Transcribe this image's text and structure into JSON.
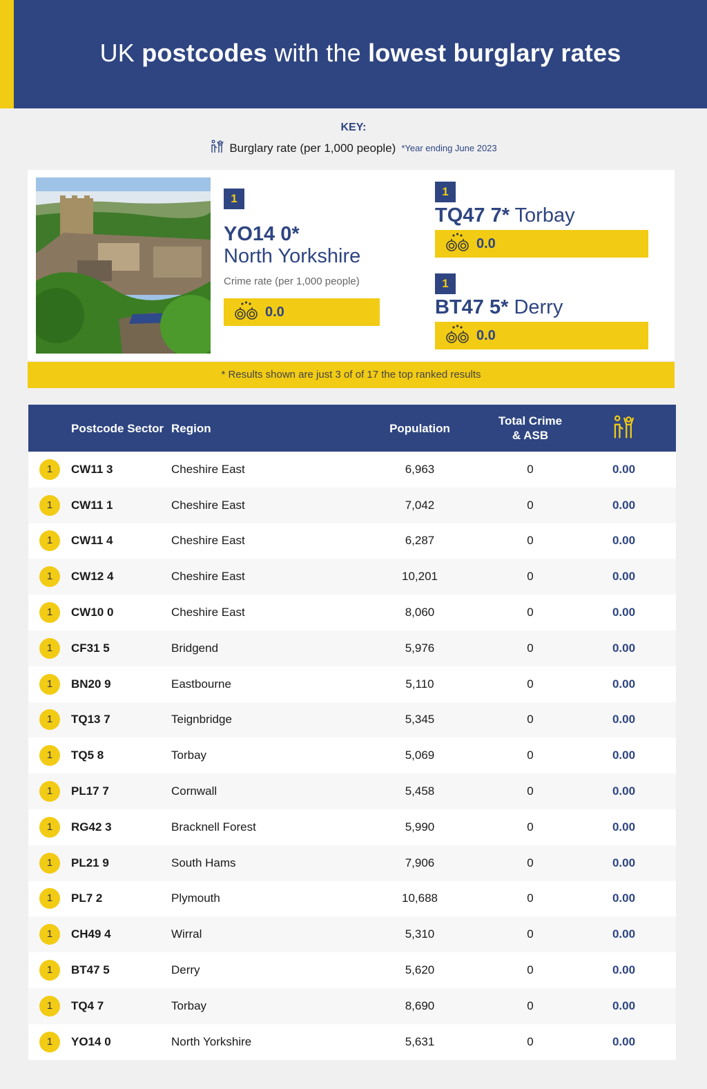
{
  "header": {
    "title_parts": [
      {
        "text": "UK ",
        "bold": false
      },
      {
        "text": "postcodes",
        "bold": true
      },
      {
        "text": " with the ",
        "bold": false
      },
      {
        "text": "lowest burglary rates",
        "bold": true
      }
    ]
  },
  "key": {
    "label": "KEY:",
    "icon": "burglary-figures-icon",
    "text": "Burglary rate (per 1,000 people)",
    "note": "*Year ending June 2023"
  },
  "featured": {
    "primary": {
      "rank": "1",
      "code": "YO14 0*",
      "region": "North Yorkshire",
      "caption": "Crime rate (per 1,000 people)",
      "icon": "handcuffs-icon",
      "rate": "0.0",
      "image_alt": "Town with castle keep among green trees"
    },
    "secondary": [
      {
        "rank": "1",
        "code": "TQ47 7*",
        "region": "Torbay",
        "icon": "handcuffs-icon",
        "rate": "0.0"
      },
      {
        "rank": "1",
        "code": "BT47 5*",
        "region": "Derry",
        "icon": "handcuffs-icon",
        "rate": "0.0"
      }
    ]
  },
  "note": "*  Results shown are just 3 of of 17 the top ranked results",
  "table": {
    "headers": {
      "code": "Postcode Sector",
      "region": "Region",
      "population": "Population",
      "total": "Total Crime & ASB",
      "rate_icon": "burglary-figures-icon"
    },
    "rows": [
      {
        "rank": "1",
        "code": "CW11 3",
        "region": "Cheshire East",
        "population": "6,963",
        "total": "0",
        "rate": "0.00"
      },
      {
        "rank": "1",
        "code": "CW11 1",
        "region": "Cheshire East",
        "population": "7,042",
        "total": "0",
        "rate": "0.00"
      },
      {
        "rank": "1",
        "code": "CW11 4",
        "region": "Cheshire East",
        "population": "6,287",
        "total": "0",
        "rate": "0.00"
      },
      {
        "rank": "1",
        "code": "CW12 4",
        "region": "Cheshire East",
        "population": "10,201",
        "total": "0",
        "rate": "0.00"
      },
      {
        "rank": "1",
        "code": "CW10 0",
        "region": "Cheshire East",
        "population": "8,060",
        "total": "0",
        "rate": "0.00"
      },
      {
        "rank": "1",
        "code": "CF31 5",
        "region": "Bridgend",
        "population": "5,976",
        "total": "0",
        "rate": "0.00"
      },
      {
        "rank": "1",
        "code": "BN20 9",
        "region": "Eastbourne",
        "population": "5,110",
        "total": "0",
        "rate": "0.00"
      },
      {
        "rank": "1",
        "code": "TQ13 7",
        "region": "Teignbridge",
        "population": "5,345",
        "total": "0",
        "rate": "0.00"
      },
      {
        "rank": "1",
        "code": "TQ5 8",
        "region": "Torbay",
        "population": "5,069",
        "total": "0",
        "rate": "0.00"
      },
      {
        "rank": "1",
        "code": "PL17 7",
        "region": "Cornwall",
        "population": "5,458",
        "total": "0",
        "rate": "0.00"
      },
      {
        "rank": "1",
        "code": "RG42 3",
        "region": "Bracknell Forest",
        "population": "5,990",
        "total": "0",
        "rate": "0.00"
      },
      {
        "rank": "1",
        "code": "PL21 9",
        "region": "South Hams",
        "population": "7,906",
        "total": "0",
        "rate": "0.00"
      },
      {
        "rank": "1",
        "code": "PL7 2",
        "region": "Plymouth",
        "population": "10,688",
        "total": "0",
        "rate": "0.00"
      },
      {
        "rank": "1",
        "code": "CH49 4",
        "region": "Wirral",
        "population": "5,310",
        "total": "0",
        "rate": "0.00"
      },
      {
        "rank": "1",
        "code": "BT47 5",
        "region": "Derry",
        "population": "5,620",
        "total": "0",
        "rate": "0.00"
      },
      {
        "rank": "1",
        "code": "TQ4 7",
        "region": "Torbay",
        "population": "8,690",
        "total": "0",
        "rate": "0.00"
      },
      {
        "rank": "1",
        "code": "YO14 0",
        "region": "North Yorkshire",
        "population": "5,631",
        "total": "0",
        "rate": "0.00"
      }
    ]
  },
  "colors": {
    "navy": "#2e4581",
    "yellow": "#f2cb14",
    "background": "#f0f0f1"
  }
}
